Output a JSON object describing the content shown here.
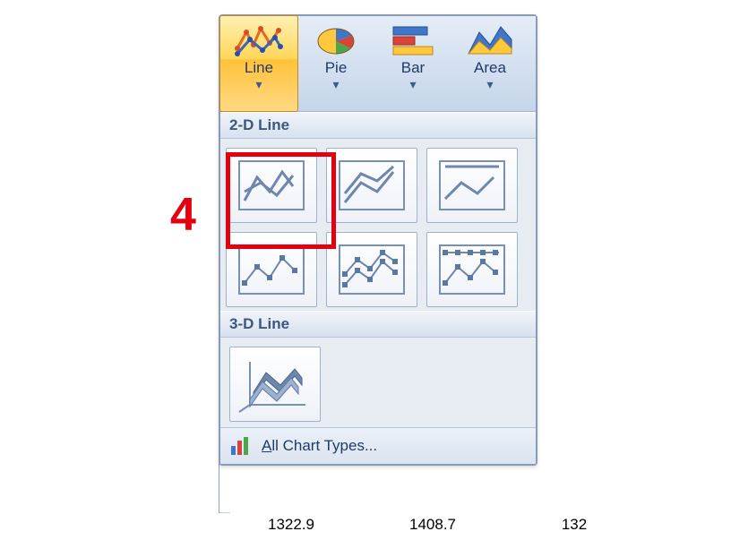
{
  "ribbon": {
    "items": [
      {
        "label": "Line",
        "active": true,
        "icon": "line-chart-icon"
      },
      {
        "label": "Pie",
        "active": false,
        "icon": "pie-chart-icon"
      },
      {
        "label": "Bar",
        "active": false,
        "icon": "bar-chart-icon"
      },
      {
        "label": "Area",
        "active": false,
        "icon": "area-chart-icon"
      }
    ]
  },
  "sections": {
    "line2d": {
      "title": "2-D Line",
      "options": [
        "line",
        "stacked-line",
        "100pct-stacked-line",
        "line-markers",
        "stacked-line-markers",
        "100pct-stacked-line-markers"
      ]
    },
    "line3d": {
      "title": "3-D Line",
      "options": [
        "3d-line"
      ]
    }
  },
  "bottom": {
    "all_chart_types_prefix": "A",
    "all_chart_types_rest": "ll Chart Types..."
  },
  "annotation": {
    "number": "4"
  },
  "cells_below": [
    "1322.9",
    "1408.7",
    "132"
  ]
}
